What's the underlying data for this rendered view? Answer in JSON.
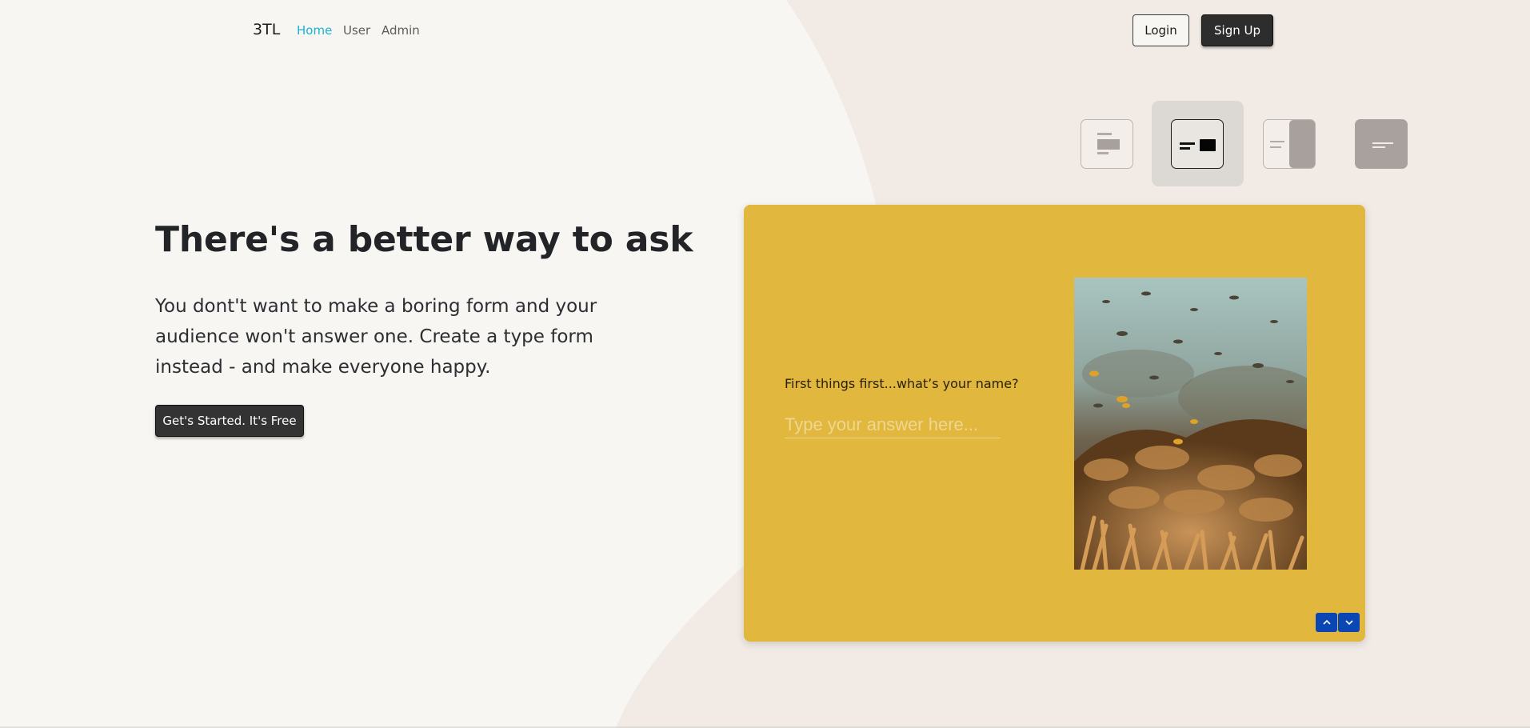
{
  "nav": {
    "brand": "3TL",
    "links": [
      {
        "label": "Home",
        "active": true
      },
      {
        "label": "User",
        "active": false
      },
      {
        "label": "Admin",
        "active": false
      }
    ],
    "login_label": "Login",
    "signup_label": "Sign Up"
  },
  "layout_switcher": {
    "options": [
      "layout-stack-icon",
      "layout-split-icon",
      "layout-side-image-icon",
      "layout-full-image-icon"
    ],
    "selected_index": 1
  },
  "hero": {
    "title": "There's a better way to ask",
    "subtitle": "You dont't want to make a boring form and your audience won't answer one. Create a type form instead - and make everyone happy.",
    "cta_label": "Get's Started. It's Free"
  },
  "preview": {
    "question": "First things first...what’s your name?",
    "answer_placeholder": "Type your answer here...",
    "image": "underwater-coral-reef-photo",
    "nav_up_icon": "chevron-up-icon",
    "nav_down_icon": "chevron-down-icon"
  },
  "colors": {
    "accent_link": "#19b3d6",
    "card_bg": "#e2b73e",
    "nav_button": "#0a47b4",
    "dark_button": "#2d2d2d",
    "page_bg": "#f7f6f2",
    "blob_bg": "#f2ebe5"
  }
}
